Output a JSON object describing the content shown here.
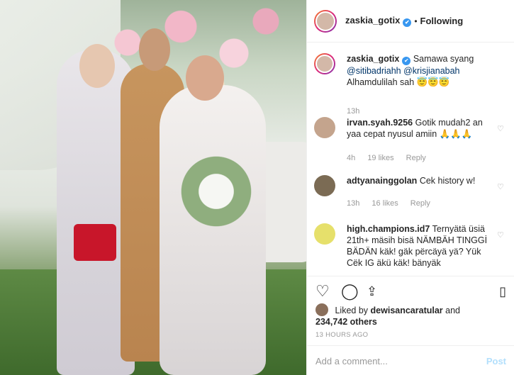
{
  "post": {
    "header": {
      "username": "zaskia_gotix",
      "verified_mark": "✔",
      "separator": "•",
      "follow_status": "Following"
    },
    "caption": {
      "username": "zaskia_gotix",
      "text_before": "Samawa syang",
      "mention1": "@sitibadriahh",
      "mention2": "@krisjianabah",
      "text_after": "Alhamdulilah sah 😇😇😇",
      "age": "13h"
    },
    "comments": [
      {
        "username": "irvan.syah.9256",
        "text": "Gotik mudah2 an yaa cepat nyusul amiin 🙏🙏🙏",
        "age": "4h",
        "likes": "19 likes",
        "reply": "Reply"
      },
      {
        "username": "adtyanainggolan",
        "text": "Cek history w!",
        "age": "13h",
        "likes": "16 likes",
        "reply": "Reply"
      },
      {
        "username": "high.champions.id7",
        "text": "Ternyätä üsiä 21th+ mäsih bisä NÄMBÄH TINGGİ BÄDÄN käk! gäk përcäyä yä? Yük Cëk IG äkü käk! bänyäk"
      }
    ],
    "actions": {
      "like_icon": "heart-outline-icon",
      "comment_icon": "comment-icon",
      "share_icon": "share-icon",
      "save_icon": "bookmark-icon"
    },
    "liked_by": {
      "prefix": "Liked by",
      "user": "dewisancaratular",
      "and": "and",
      "others": "234,742 others"
    },
    "timestamp": "13 HOURS AGO",
    "add_comment": {
      "placeholder": "Add a comment...",
      "post_label": "Post"
    }
  }
}
